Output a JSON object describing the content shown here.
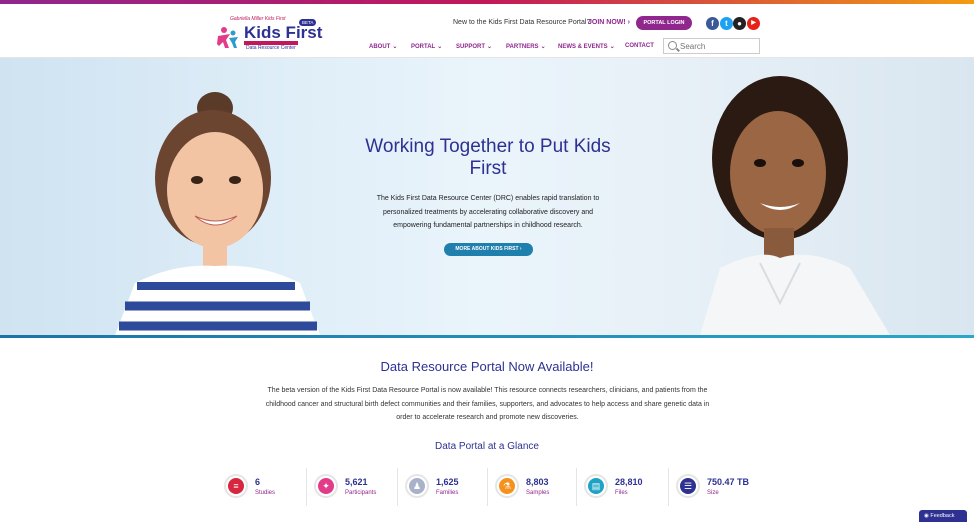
{
  "header": {
    "logo": {
      "tagline": "Gabriella Miller Kids First",
      "name": "Kids First",
      "subtitle": "Data Resource Center",
      "badge": "BETA"
    },
    "new_prompt": "New to the Kids First Data Resource Portal?",
    "join_label": "JOIN NOW!",
    "login_label": "PORTAL LOGIN",
    "social": [
      {
        "icon": "facebook-icon",
        "glyph": "f",
        "color": "#3b5998"
      },
      {
        "icon": "twitter-icon",
        "glyph": "t",
        "color": "#1da1f2"
      },
      {
        "icon": "github-icon",
        "glyph": "●",
        "color": "#222222"
      },
      {
        "icon": "youtube-icon",
        "glyph": "▶",
        "color": "#e62117"
      }
    ],
    "nav": [
      "ABOUT",
      "PORTAL",
      "SUPPORT",
      "PARTNERS",
      "NEWS & EVENTS",
      "CONTACT"
    ],
    "search_placeholder": "Search"
  },
  "hero": {
    "title": "Working Together to Put Kids First",
    "body": "The Kids First Data Resource Center (DRC) enables rapid translation to personalized treatments by accelerating collaborative discovery and empowering fundamental partnerships in childhood research.",
    "button_label": "MORE ABOUT KIDS FIRST"
  },
  "portal": {
    "title": "Data Resource Portal Now Available!",
    "body": "The beta version of the Kids First Data Resource Portal is now available! This resource connects researchers, clinicians, and patients from the childhood cancer and structural birth defect communities and their families, supporters, and advocates to help access and share genetic data in order to accelerate research and promote new discoveries.",
    "glance_title": "Data Portal at a Glance",
    "stats": [
      {
        "value": "6",
        "label": "Studies",
        "icon": "studies-icon",
        "color": "#d7263d"
      },
      {
        "value": "5,621",
        "label": "Participants",
        "icon": "participants-icon",
        "color": "#e23b8a"
      },
      {
        "value": "1,625",
        "label": "Families",
        "icon": "families-icon",
        "color": "#a8b2c8"
      },
      {
        "value": "8,803",
        "label": "Samples",
        "icon": "samples-icon",
        "color": "#f5921e"
      },
      {
        "value": "28,810",
        "label": "Files",
        "icon": "files-icon",
        "color": "#1ca3c6"
      },
      {
        "value": "750.47 TB",
        "label": "Size",
        "icon": "size-icon",
        "color": "#2e3192"
      }
    ]
  },
  "feedback_label": "Feedback"
}
